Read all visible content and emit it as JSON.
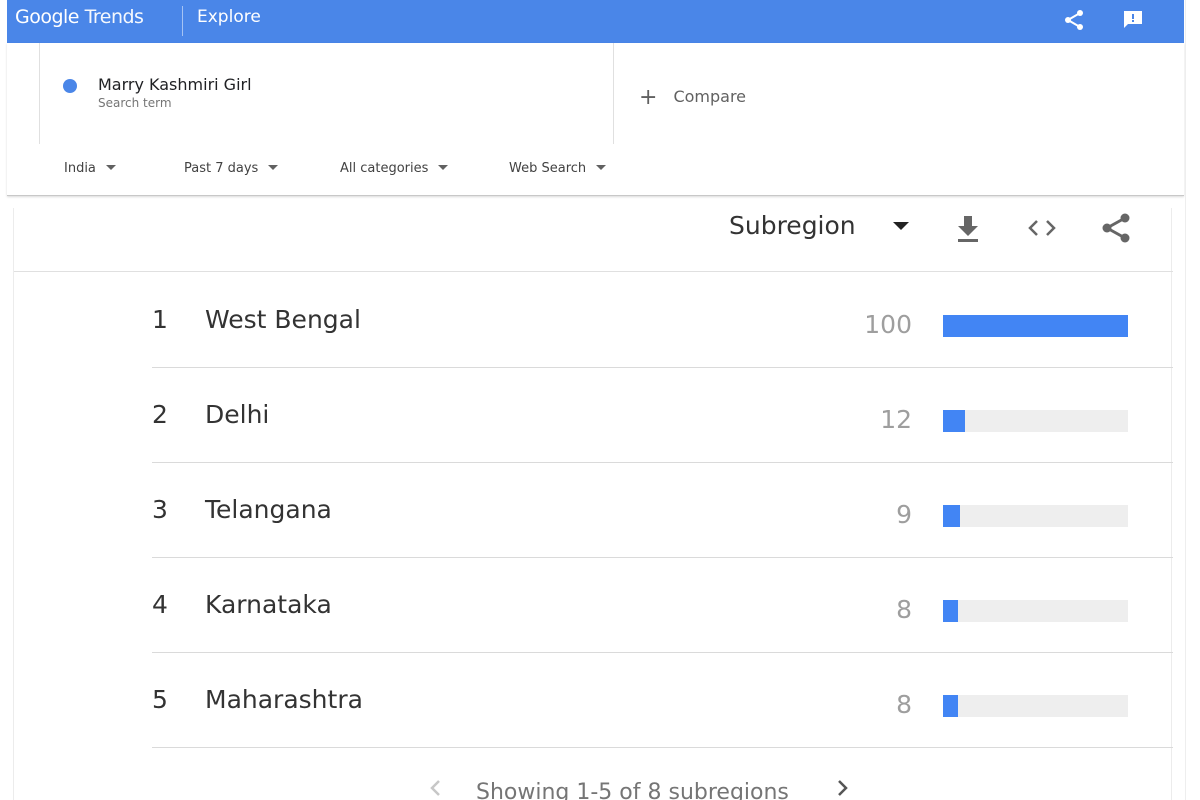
{
  "appbar": {
    "logo_google": "Google",
    "logo_trends": "Trends",
    "explore_label": "Explore",
    "icons": [
      "share-icon",
      "feedback-icon"
    ],
    "color": "#4a86e8"
  },
  "search": {
    "term": "Marry Kashmiri Girl",
    "term_sublabel": "Search term",
    "term_color": "#4a86e8",
    "compare_plus": "+",
    "compare_label": "Compare"
  },
  "filters": {
    "location": "India",
    "time": "Past 7 days",
    "category": "All categories",
    "search_type": "Web Search"
  },
  "card": {
    "resolution_label": "Subregion",
    "icons": [
      "download-icon",
      "embed-icon",
      "share-icon"
    ],
    "rows": [
      {
        "rank": "1",
        "name": "West Bengal",
        "value": "100",
        "fraction": 1.0
      },
      {
        "rank": "2",
        "name": "Delhi",
        "value": "12",
        "fraction": 0.12
      },
      {
        "rank": "3",
        "name": "Telangana",
        "value": "9",
        "fraction": 0.09
      },
      {
        "rank": "4",
        "name": "Karnataka",
        "value": "8",
        "fraction": 0.08
      },
      {
        "rank": "5",
        "name": "Maharashtra",
        "value": "8",
        "fraction": 0.08
      }
    ],
    "bar_color": "#4285f4",
    "pagination_text": "Showing 1-5 of 8 subregions"
  }
}
